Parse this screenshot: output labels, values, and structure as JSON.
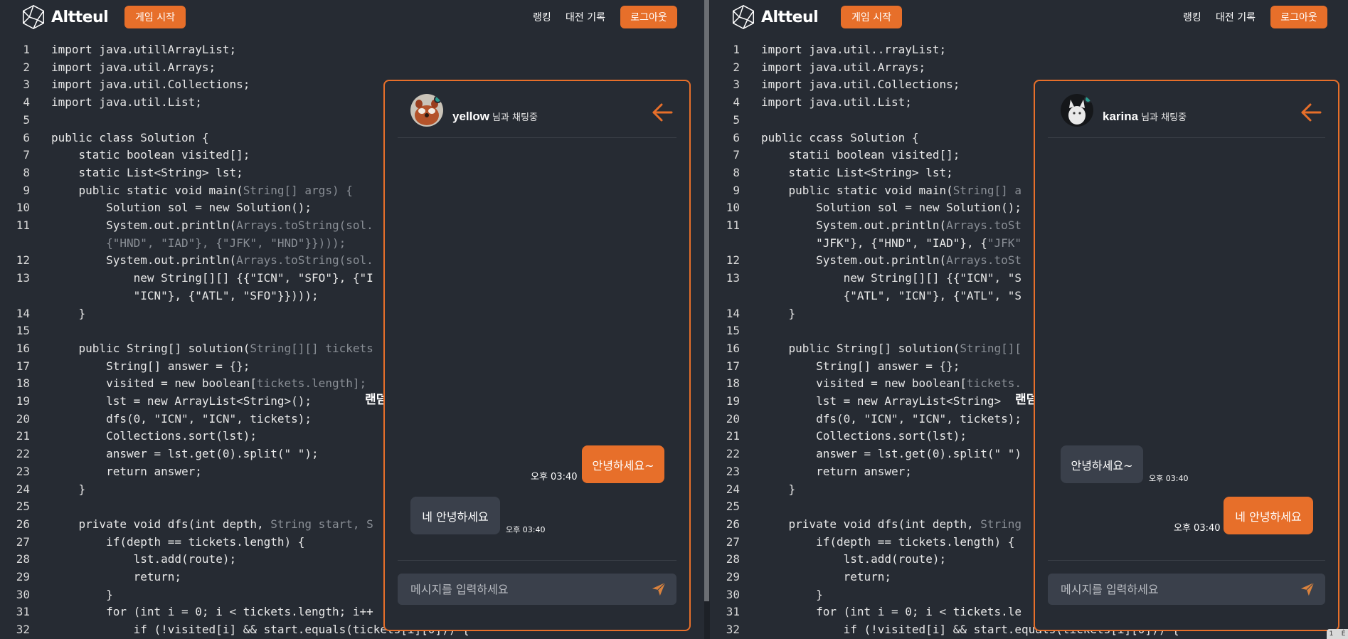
{
  "left": {
    "header": {
      "logo_text": "Altteul",
      "start_label": "게임 시작",
      "ranking_label": "랭킹",
      "history_label": "대전 기록",
      "logout_label": "로그아웃"
    },
    "code": [
      {
        "n": "1",
        "t": "import java.utillArrayList;",
        "d": ""
      },
      {
        "n": "2",
        "t": "import java.util.Arrays;",
        "d": ""
      },
      {
        "n": "3",
        "t": "import java.util.Collections;",
        "d": ""
      },
      {
        "n": "4",
        "t": "import java.util.List;",
        "d": ""
      },
      {
        "n": "5",
        "t": "",
        "d": ""
      },
      {
        "n": "6",
        "t": "public class Solution {",
        "d": ""
      },
      {
        "n": "7",
        "t": "    static boolean visited[];",
        "d": ""
      },
      {
        "n": "8",
        "t": "    static List<String> lst;",
        "d": ""
      },
      {
        "n": "9",
        "t": "    public static void main(",
        "d": "String[] args) {"
      },
      {
        "n": "10",
        "t": "        Solution sol = new Solution();",
        "d": ""
      },
      {
        "n": "11",
        "t": "        System.out.println(",
        "d": "Arrays.toString(sol."
      },
      {
        "n": "",
        "t": "        ",
        "d": "{\"HND\", \"IAD\"}, {\"JFK\", \"HND\"}})));"
      },
      {
        "n": "12",
        "t": "        System.out.println(",
        "d": "Arrays.toString(sol."
      },
      {
        "n": "13",
        "t": "            new String[][] {{\"ICN\", \"SFO\"}, {\"I",
        "d": ""
      },
      {
        "n": "",
        "t": "            \"ICN\"}, {\"ATL\", \"SFO\"}})));",
        "d": ""
      },
      {
        "n": "14",
        "t": "    }",
        "d": ""
      },
      {
        "n": "15",
        "t": "",
        "d": ""
      },
      {
        "n": "16",
        "t": "    public String[] solution(",
        "d": "String[][] tickets"
      },
      {
        "n": "17",
        "t": "        String[] answer = {};",
        "d": ""
      },
      {
        "n": "18",
        "t": "        visited = new boolean[",
        "d": "tickets.length];"
      },
      {
        "n": "19",
        "t": "        lst = new ArrayList<String>();",
        "d": ""
      },
      {
        "n": "20",
        "t": "        dfs(0, \"ICN\", \"ICN\", tickets);",
        "d": ""
      },
      {
        "n": "21",
        "t": "        Collections.sort(lst);",
        "d": ""
      },
      {
        "n": "22",
        "t": "        answer = lst.get(0).split(\" \");",
        "d": ""
      },
      {
        "n": "23",
        "t": "        return answer;",
        "d": ""
      },
      {
        "n": "24",
        "t": "    }",
        "d": ""
      },
      {
        "n": "25",
        "t": "",
        "d": ""
      },
      {
        "n": "26",
        "t": "    private void dfs(int depth, ",
        "d": "String start, S"
      },
      {
        "n": "27",
        "t": "        if(depth == tickets.length) {",
        "d": ""
      },
      {
        "n": "28",
        "t": "            lst.add(route);",
        "d": ""
      },
      {
        "n": "29",
        "t": "            return;",
        "d": ""
      },
      {
        "n": "30",
        "t": "        }",
        "d": ""
      },
      {
        "n": "31",
        "t": "        for (int i = 0; i < tickets.length; i++",
        "d": ""
      },
      {
        "n": "32",
        "t": "            if (!visited[i] && start.equals(tickets[i][0])) {",
        "d": ""
      }
    ],
    "random_text": "랜덤",
    "chat": {
      "name": "yellow",
      "status": "님과 채팅중",
      "messages": [
        {
          "text": "안녕하세요~",
          "time": "오후 03:40"
        },
        {
          "text": "네 안녕하세요",
          "time": "오후 03:40"
        }
      ],
      "placeholder": "메시지를 입력하세요"
    }
  },
  "right": {
    "header": {
      "logo_text": "Altteul",
      "start_label": "게임 시작",
      "ranking_label": "랭킹",
      "history_label": "대전 기록",
      "logout_label": "로그아웃"
    },
    "code": [
      {
        "n": "1",
        "t": "import java.util..rrayList;",
        "d": ""
      },
      {
        "n": "2",
        "t": "import java.util.Arrays;",
        "d": ""
      },
      {
        "n": "3",
        "t": "import java.util.Collections;",
        "d": ""
      },
      {
        "n": "4",
        "t": "import java.util.List;",
        "d": ""
      },
      {
        "n": "5",
        "t": "",
        "d": ""
      },
      {
        "n": "6",
        "t": "public ccass Solution {",
        "d": ""
      },
      {
        "n": "7",
        "t": "    statii boolean visited[];",
        "d": ""
      },
      {
        "n": "8",
        "t": "    static List<String> lst;",
        "d": ""
      },
      {
        "n": "9",
        "t": "    public static void main(",
        "d": "String[] a"
      },
      {
        "n": "10",
        "t": "        Solution sol = new Solution();",
        "d": ""
      },
      {
        "n": "11",
        "t": "        System.out.println(",
        "d": "Arrays.toSt"
      },
      {
        "n": "",
        "t": "        \"JFK\"}, {\"HND\", \"IAD\"}, {",
        "d": "\"JFK\""
      },
      {
        "n": "12",
        "t": "        System.out.println(",
        "d": "Arrays.toSt"
      },
      {
        "n": "13",
        "t": "            new String[][] {{\"ICN\", \"S",
        "d": ""
      },
      {
        "n": "",
        "t": "            {\"ATL\", \"ICN\"}, {\"ATL\", \"S",
        "d": ""
      },
      {
        "n": "14",
        "t": "    }",
        "d": ""
      },
      {
        "n": "15",
        "t": "",
        "d": ""
      },
      {
        "n": "16",
        "t": "    public String[] solution(",
        "d": "String[]["
      },
      {
        "n": "17",
        "t": "        String[] answer = {};",
        "d": ""
      },
      {
        "n": "18",
        "t": "        visited = new boolean[",
        "d": "tickets."
      },
      {
        "n": "19",
        "t": "        lst = new ArrayList<String>",
        "d": ""
      },
      {
        "n": "20",
        "t": "        dfs(0, \"ICN\", \"ICN\", tickets);",
        "d": ""
      },
      {
        "n": "21",
        "t": "        Collections.sort(lst);",
        "d": ""
      },
      {
        "n": "22",
        "t": "        answer = lst.get(0).split(\" \")",
        "d": ""
      },
      {
        "n": "23",
        "t": "        return answer;",
        "d": ""
      },
      {
        "n": "24",
        "t": "    }",
        "d": ""
      },
      {
        "n": "25",
        "t": "",
        "d": ""
      },
      {
        "n": "26",
        "t": "    private void dfs(int depth, ",
        "d": "String"
      },
      {
        "n": "27",
        "t": "        if(depth == tickets.length) {",
        "d": ""
      },
      {
        "n": "28",
        "t": "            lst.add(route);",
        "d": ""
      },
      {
        "n": "29",
        "t": "            return;",
        "d": ""
      },
      {
        "n": "30",
        "t": "        }",
        "d": ""
      },
      {
        "n": "31",
        "t": "        for (int i = 0; i < tickets.le",
        "d": ""
      },
      {
        "n": "32",
        "t": "            if (!visited[i] && start.equals(tickets[i][0])) {",
        "d": ""
      }
    ],
    "random_text": "랜덤",
    "chat": {
      "name": "karina",
      "status": "님과 채팅중",
      "messages": [
        {
          "text": "안녕하세요~",
          "time": "오후 03:40"
        },
        {
          "text": "네 안녕하세요",
          "time": "오후 03:40"
        }
      ],
      "placeholder": "메시지를 입력하세요"
    }
  },
  "corner_text": "1    Ѐ"
}
